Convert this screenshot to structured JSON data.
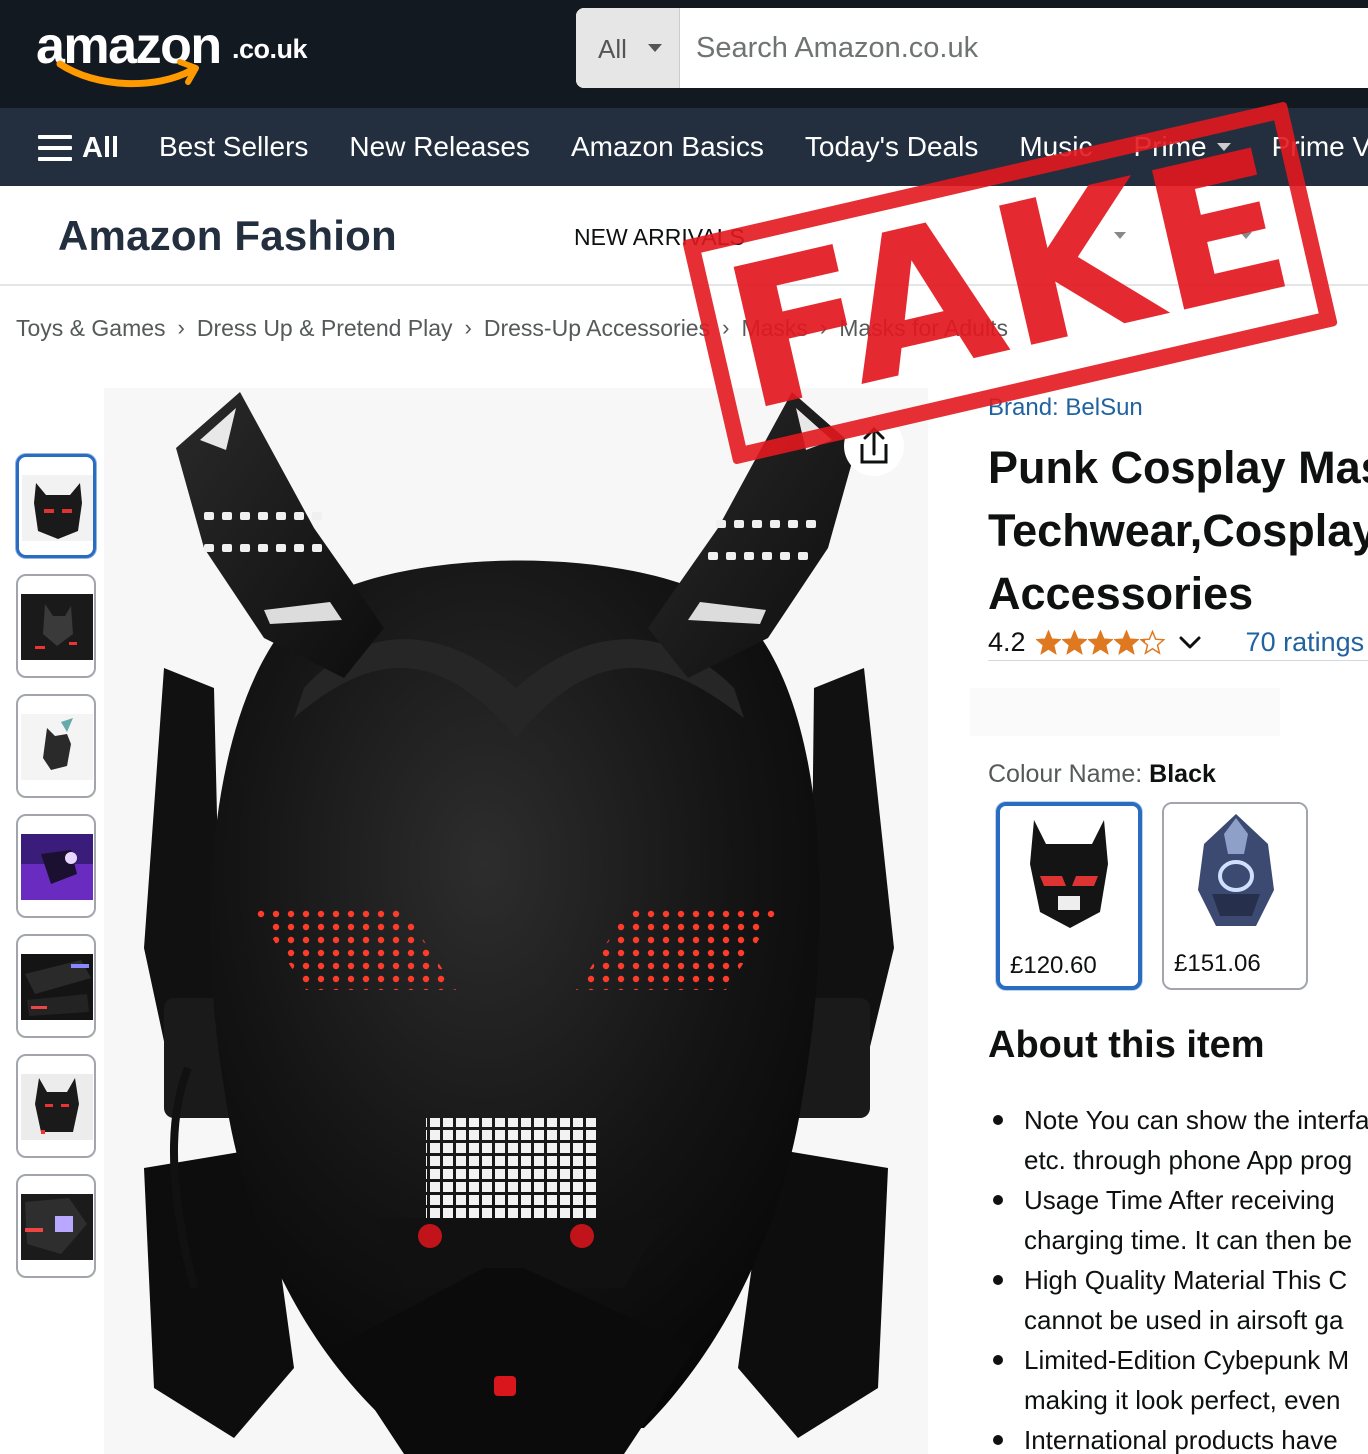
{
  "header": {
    "logo_text": "amazon",
    "logo_tld": ".co.uk",
    "search": {
      "category": "All",
      "placeholder": "Search Amazon.co.uk"
    }
  },
  "nav": {
    "all_label": "All",
    "links": [
      "Best Sellers",
      "New Releases",
      "Amazon Basics",
      "Today's Deals",
      "Music",
      "Prime",
      "Prime Video"
    ]
  },
  "fashion": {
    "title": "Amazon Fashion",
    "new_arrivals": "NEW ARRIVALS"
  },
  "breadcrumb": [
    "Toys & Games",
    "Dress Up & Pretend Play",
    "Dress-Up Accessories",
    "Masks",
    "Masks for Adults"
  ],
  "product": {
    "brand_link": "Brand: BelSun",
    "title_lines": [
      "Punk Cosplay Mask",
      "Techwear,Cosplay",
      "Accessories"
    ],
    "rating_value": "4.2",
    "rating_stars": 4.2,
    "rating_count": "70 ratings",
    "colour_label": "Colour Name: ",
    "colour_value": "Black",
    "variants": [
      {
        "price": "£120.60",
        "selected": true
      },
      {
        "price": "£151.06",
        "selected": false
      }
    ],
    "thumbnail_count": 7
  },
  "about": {
    "heading": "About this item",
    "bullets": [
      [
        "Note You can show the interface",
        "etc. through phone App prog"
      ],
      [
        "Usage Time After receiving",
        "charging time. It can then be"
      ],
      [
        "High Quality Material This C",
        "cannot be used in airsoft ga"
      ],
      [
        "Limited-Edition Cybepunk M",
        "making it look perfect, even"
      ],
      [
        "International products have"
      ]
    ]
  },
  "stamp": {
    "text": "FAKE"
  },
  "colors": {
    "header_bg": "#131921",
    "nav_bg": "#232f3e",
    "link": "#2162a1",
    "star": "#de7921",
    "stamp_red": "#e2181e",
    "selected_border": "#2a6cbf"
  }
}
